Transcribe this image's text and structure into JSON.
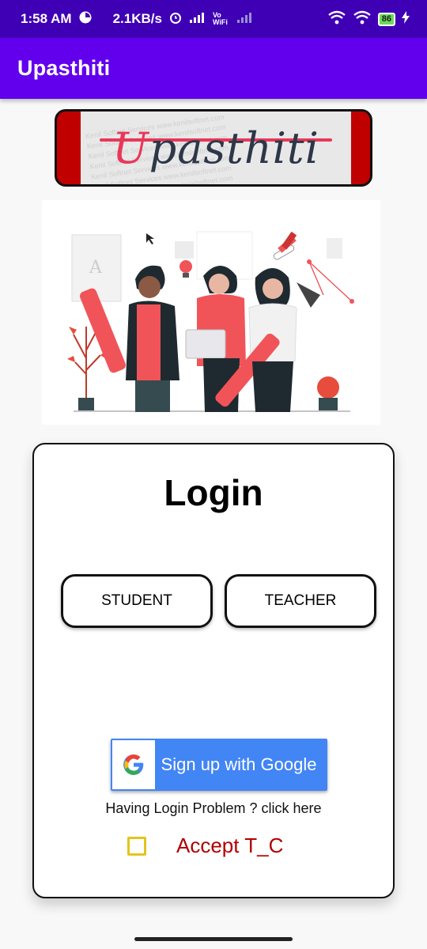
{
  "status_bar": {
    "time": "1:58 AM",
    "net_speed": "2.1KB/s",
    "volte": "Vo WiFi",
    "battery": "86",
    "icons": [
      "alarm-icon",
      "signal-icon",
      "wifi-icon",
      "battery-icon",
      "charging-icon"
    ]
  },
  "app_bar": {
    "title": "Upasthiti"
  },
  "logo": {
    "text_first": "U",
    "text_rest": "pasthiti",
    "watermark": "Kenil Softnet Services  www.kenilsoftnet.com"
  },
  "login": {
    "title": "Login",
    "student_label": "STUDENT",
    "teacher_label": "TEACHER",
    "google_label": "Sign up with Google",
    "help_text": "Having Login Problem ? click here",
    "tc_label": "Accept T_C"
  },
  "colors": {
    "status_bar": "#3f00b5",
    "app_bar": "#6200ee",
    "google_blue": "#4285f4",
    "accent_red": "#b00000",
    "checkbox": "#e2c51d"
  }
}
